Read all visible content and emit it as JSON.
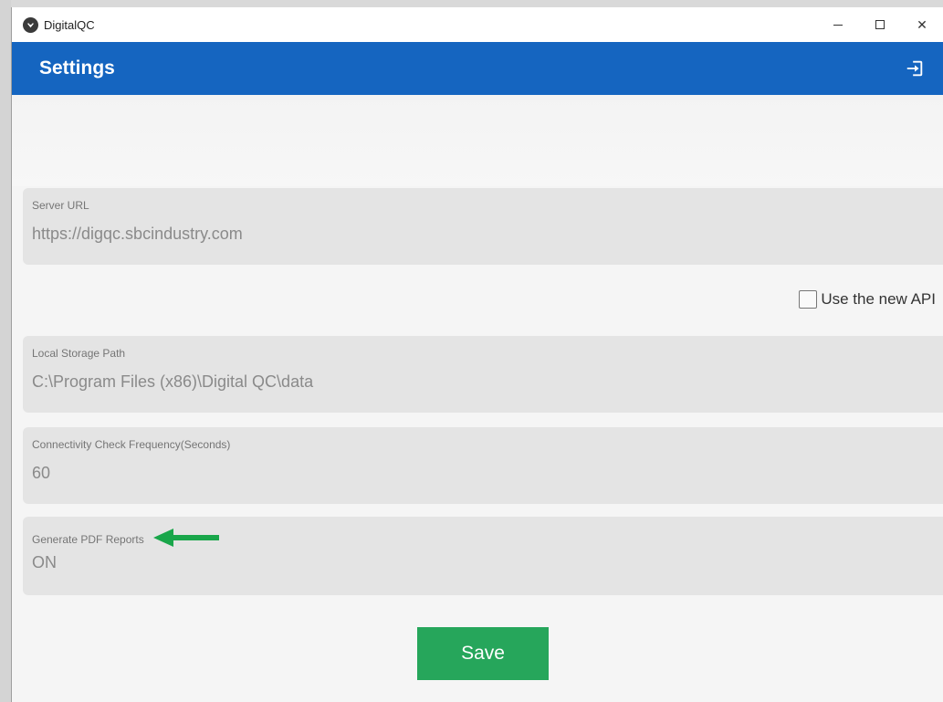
{
  "window": {
    "title": "DigitalQC",
    "app_icon": "digitalqc-logo-icon",
    "controls": {
      "minimize": "minimize-icon",
      "maximize": "maximize-icon",
      "close_label": "✕"
    }
  },
  "appbar": {
    "title": "Settings",
    "action_icon": "logout-icon",
    "color": "#1565c0"
  },
  "fields": [
    {
      "label": "Server URL",
      "value": "https://digqc.sbcindustry.com"
    },
    {
      "label": "Local Storage Path",
      "value": "C:\\Program Files (x86)\\Digital QC\\data"
    },
    {
      "label": "Connectivity Check Frequency(Seconds)",
      "value": "60"
    },
    {
      "label": "Generate PDF Reports",
      "value": "ON",
      "annotation_icon": "green-arrow-icon"
    }
  ],
  "api_option": {
    "label": "Use the new API",
    "checked": false
  },
  "save_button": {
    "label": "Save",
    "color": "#26a65b"
  }
}
